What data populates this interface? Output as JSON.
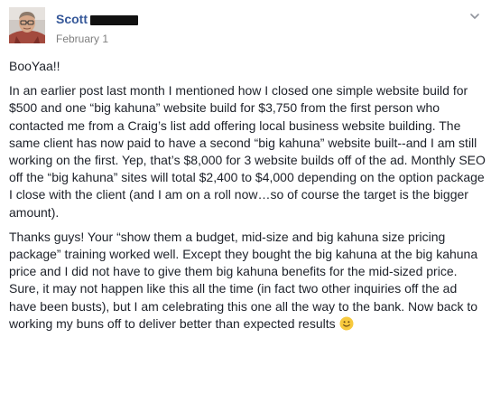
{
  "post": {
    "author_name": "Scott",
    "timestamp": "February 1",
    "paragraphs": [
      "BooYaa!!",
      "In an earlier post last month I mentioned how I closed one simple website build for $500 and one “big kahuna” website build for $3,750 from the first person who contacted me from a Craig’s list add offering local business website building. The same client has now paid to have a second “big kahuna” website built--and I am still working on the first. Yep, that’s $8,000 for 3 website builds off of the ad. Monthly SEO off the “big kahuna” sites will total $2,400 to $4,000 depending on the option package I close with the client (and I am on a roll now…so of course the target is the bigger amount).",
      "Thanks guys! Your “show them a budget, mid-size and big kahuna size pricing package” training worked well. Except they bought the big kahuna at the big kahuna price and I did not have to give them big kahuna benefits for the mid-sized price. Sure, it may not happen like this all the time (in fact two other inquiries off the ad have been busts), but I am celebrating this one all the way to the bank. Now back to working my buns off to deliver better than expected results"
    ],
    "icons": {
      "menu": "chevron-down-icon",
      "emoji": "smile-emoji-icon"
    },
    "colors": {
      "author_link": "#365899",
      "text": "#1d2129",
      "timestamp": "#7f7f7f",
      "emoji": "#f7c93d"
    }
  }
}
